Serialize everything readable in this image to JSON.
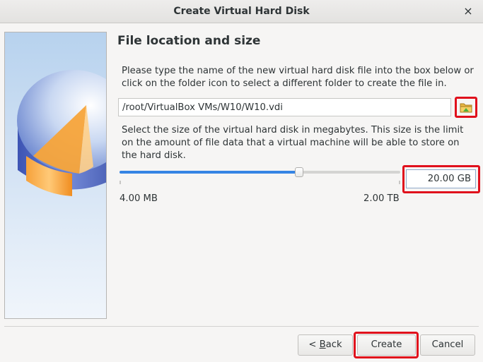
{
  "window": {
    "title": "Create Virtual Hard Disk",
    "close_label": "×"
  },
  "page": {
    "heading": "File location and size",
    "location_description": "Please type the name of the new virtual hard disk file into the box below or click on the folder icon to select a different folder to create the file in.",
    "size_description": "Select the size of the virtual hard disk in megabytes. This size is the limit on the amount of file data that a virtual machine will be able to store on the hard disk."
  },
  "location": {
    "path_value": "/root/VirtualBox VMs/W10/W10.vdi",
    "folder_icon": "folder-icon"
  },
  "size": {
    "value_text": "20.00 GB",
    "slider_min_label": "4.00 MB",
    "slider_max_label": "2.00 TB",
    "slider_fraction": 0.64
  },
  "buttons": {
    "back_prefix": "< ",
    "back_mnemonic": "B",
    "back_rest": "ack",
    "create_label": "Create",
    "cancel_label": "Cancel"
  },
  "colors": {
    "accent": "#3584e4",
    "highlight": "#e0101c"
  }
}
